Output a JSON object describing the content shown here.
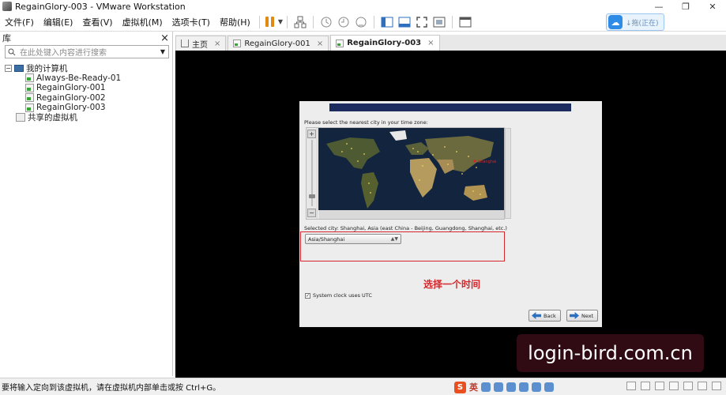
{
  "window": {
    "title": "RegainGlory-003 - VMware Workstation"
  },
  "window_controls": {
    "minimize": "—",
    "restore": "❐",
    "close": "✕"
  },
  "menu": [
    "文件(F)",
    "编辑(E)",
    "查看(V)",
    "虚拟机(M)",
    "选项卡(T)",
    "帮助(H)"
  ],
  "cloud_badge": {
    "text": "↓拖(正在)"
  },
  "library": {
    "title": "库",
    "close": "×",
    "search_placeholder": "在此处键入内容进行搜索",
    "tree": {
      "root": "我的计算机",
      "vms": [
        "Always-Be-Ready-01",
        "RegainGlory-001",
        "RegainGlory-002",
        "RegainGlory-003"
      ],
      "shared": "共享的虚拟机"
    }
  },
  "tabs": [
    {
      "label": "主页",
      "close": "×",
      "active": false
    },
    {
      "label": "RegainGlory-001",
      "close": "×",
      "active": false
    },
    {
      "label": "RegainGlory-003",
      "close": "×",
      "active": true
    }
  ],
  "installer": {
    "prompt": "Please select the nearest city in your time zone:",
    "selected_city": "Selected city: Shanghai, Asia (east China - Beijing, Guangdong, Shanghai, etc.)",
    "timezone_value": "Asia/Shanghai",
    "utc_label": "System clock uses UTC",
    "utc_checked": true,
    "back_label": "Back",
    "next_label": "Next",
    "map_marker_label": "Shanghai"
  },
  "annotation": {
    "text": "选择一个时间",
    "color": "#d5262b"
  },
  "watermark": {
    "text": "login-bird.com.cn"
  },
  "statusbar": {
    "message": "要将输入定向到该虚拟机，请在虚拟机内部单击或按 Ctrl+G。",
    "ime_lang": "英"
  },
  "colors": {
    "accent": "#2e6fc0",
    "pause": "#e08a12",
    "highlight": "#d5262b"
  }
}
